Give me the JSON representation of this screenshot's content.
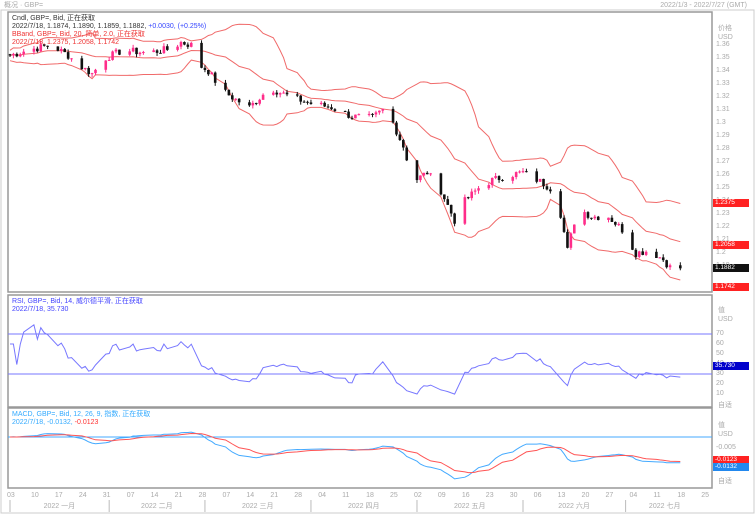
{
  "window": {
    "title": "概况 · GBP=",
    "range": "2022/1/3 - 2022/7/27 (GMT)"
  },
  "price_panel": {
    "legend1": "Cndl, GBP=, Bid, 正在获取",
    "legend1_values": "2022/7/18, 1.1874, 1.1890, 1.1859, 1.1882,",
    "legend1_change": "+0.0030, (+0.25%)",
    "legend2": "BBand, GBP=, Bid, 20, 简单, 2.0, 正在获取",
    "legend2_values": "2022/7/18, 1.2375, 1.2058, 1.1742",
    "axis_title": "价格",
    "axis_unit": "USD",
    "ticks": [
      "1.36",
      "1.35",
      "1.34",
      "1.33",
      "1.32",
      "1.31",
      "1.3",
      "1.29",
      "1.28",
      "1.27",
      "1.26",
      "1.25",
      "1.24",
      "1.23",
      "1.22",
      "1.21",
      "1.2",
      "1.19"
    ],
    "upper_label": "1.2375",
    "mid_label": "1.2058",
    "last_label": "1.1882",
    "lower_label": "1.1742"
  },
  "rsi_panel": {
    "legend": "RSI, GBP=, Bid, 14, 威尔德平滑, 正在获取",
    "legend_values": "2022/7/18, 35.730",
    "axis_title": "值",
    "axis_unit": "USD",
    "ticks": [
      "70",
      "60",
      "50",
      "40",
      "30",
      "20",
      "10"
    ],
    "value_label": "35.730",
    "footer": "自适"
  },
  "macd_panel": {
    "legend": "MACD, GBP=, Bid, 12, 26, 9, 指数, 正在获取",
    "legend_values": "2022/7/18, -0.0132,",
    "legend_signal": "-0.0123",
    "axis_title": "值",
    "axis_unit": "USD",
    "ticks": [
      "-0.005"
    ],
    "signal_label": "-0.0123",
    "macd_label": "-0.0132",
    "footer": "自适"
  },
  "x_axis": {
    "days": [
      "03",
      "10",
      "17",
      "24",
      "31",
      "07",
      "14",
      "21",
      "28",
      "07",
      "14",
      "21",
      "28",
      "04",
      "11",
      "18",
      "25",
      "02",
      "09",
      "16",
      "23",
      "30",
      "06",
      "13",
      "20",
      "27",
      "04",
      "11",
      "18",
      "25"
    ],
    "months": [
      "2022 一月",
      "2022 二月",
      "2022 三月",
      "2022 四月",
      "2022 五月",
      "2022 六月",
      "2022 七月"
    ]
  },
  "colors": {
    "up": "#ff2d8a",
    "down": "#111111",
    "bb": "#f06a6a",
    "rsi": "#7777ff",
    "macd": "#44aaff",
    "signal": "#ff5555"
  },
  "chart_data": {
    "type": "line",
    "title": "GBP= Daily Candles with Bollinger Bands, RSI, MACD",
    "x_unit": "calendar day since 2022-01-03",
    "close_keypoints": [
      [
        0,
        1.352
      ],
      [
        5,
        1.356
      ],
      [
        12,
        1.36
      ],
      [
        17,
        1.352
      ],
      [
        21,
        1.343
      ],
      [
        24,
        1.338
      ],
      [
        28,
        1.35
      ],
      [
        33,
        1.356
      ],
      [
        40,
        1.354
      ],
      [
        47,
        1.357
      ],
      [
        50,
        1.362
      ],
      [
        53,
        1.36
      ],
      [
        55,
        1.345
      ],
      [
        58,
        1.34
      ],
      [
        62,
        1.325
      ],
      [
        66,
        1.318
      ],
      [
        70,
        1.312
      ],
      [
        76,
        1.327
      ],
      [
        82,
        1.32
      ],
      [
        88,
        1.315
      ],
      [
        94,
        1.312
      ],
      [
        100,
        1.305
      ],
      [
        106,
        1.304
      ],
      [
        109,
        1.31
      ],
      [
        112,
        1.3
      ],
      [
        115,
        1.282
      ],
      [
        118,
        1.255
      ],
      [
        122,
        1.262
      ],
      [
        126,
        1.248
      ],
      [
        130,
        1.225
      ],
      [
        133,
        1.24
      ],
      [
        137,
        1.25
      ],
      [
        141,
        1.256
      ],
      [
        146,
        1.26
      ],
      [
        150,
        1.262
      ],
      [
        155,
        1.255
      ],
      [
        158,
        1.25
      ],
      [
        161,
        1.23
      ],
      [
        163,
        1.202
      ],
      [
        166,
        1.235
      ],
      [
        170,
        1.228
      ],
      [
        175,
        1.228
      ],
      [
        179,
        1.218
      ],
      [
        183,
        1.2
      ],
      [
        187,
        1.202
      ],
      [
        191,
        1.195
      ],
      [
        194,
        1.186
      ],
      [
        196,
        1.1882
      ]
    ],
    "ylim": [
      1.175,
      1.37
    ],
    "rsi_levels": [
      30,
      70
    ]
  }
}
